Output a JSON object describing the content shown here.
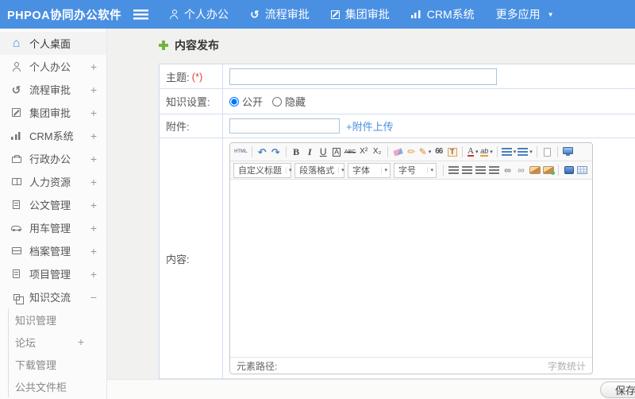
{
  "navbar": {
    "logo": "PHPOA协同办公软件",
    "items": [
      {
        "id": "personal-office",
        "label": "个人办公",
        "icon": "user-icon"
      },
      {
        "id": "workflow-approval",
        "label": "流程审批",
        "icon": "flow-icon"
      },
      {
        "id": "group-approval",
        "label": "集团审批",
        "icon": "edit-icon"
      },
      {
        "id": "crm-system",
        "label": "CRM系统",
        "icon": "chart-icon"
      },
      {
        "id": "more-apps",
        "label": "更多应用",
        "icon": null,
        "caret": true
      }
    ]
  },
  "sidebar": {
    "items": [
      {
        "id": "personal-desktop",
        "label": "个人桌面",
        "icon": "home-icon",
        "active": true
      },
      {
        "id": "personal-office",
        "label": "个人办公",
        "icon": "user-icon",
        "expander": "+"
      },
      {
        "id": "workflow-approval",
        "label": "流程审批",
        "icon": "flow-icon",
        "expander": "+"
      },
      {
        "id": "group-approval",
        "label": "集团审批",
        "icon": "edit-icon",
        "expander": "+"
      },
      {
        "id": "crm-system",
        "label": "CRM系统",
        "icon": "chart-icon",
        "expander": "+"
      },
      {
        "id": "admin-office",
        "label": "行政办公",
        "icon": "briefcase-icon",
        "expander": "+"
      },
      {
        "id": "human-resources",
        "label": "人力资源",
        "icon": "book-icon",
        "expander": "+"
      },
      {
        "id": "document-management",
        "label": "公文管理",
        "icon": "document-icon",
        "expander": "+"
      },
      {
        "id": "vehicle-management",
        "label": "用车管理",
        "icon": "car-icon",
        "expander": "+"
      },
      {
        "id": "archive-management",
        "label": "档案管理",
        "icon": "archive-icon",
        "expander": "+"
      },
      {
        "id": "project-management",
        "label": "项目管理",
        "icon": "project-icon",
        "expander": "+"
      },
      {
        "id": "knowledge-exchange",
        "label": "知识交流",
        "icon": "knowledge-icon",
        "expander": "−",
        "expanded": true
      }
    ],
    "subitems": [
      {
        "id": "knowledge-management",
        "label": "知识管理"
      },
      {
        "id": "forum",
        "label": "论坛",
        "expander": "+"
      },
      {
        "id": "download-management",
        "label": "下载管理"
      },
      {
        "id": "public-file-cabinet",
        "label": "公共文件柜"
      }
    ]
  },
  "main": {
    "title": "内容发布",
    "form": {
      "subject_label": "主题:",
      "required_mark": "(*)",
      "subject_value": "",
      "knowledge_label": "知识设置:",
      "knowledge_options": [
        {
          "id": "public",
          "label": "公开",
          "selected": true
        },
        {
          "id": "hidden",
          "label": "隐藏",
          "selected": false
        }
      ],
      "attachment_label": "附件:",
      "attachment_value": "",
      "attachment_upload_link": "+附件上传",
      "content_label": "内容:"
    },
    "editor": {
      "toolbar_row1": [
        {
          "icon": "html-source-icon"
        },
        {
          "sep": true
        },
        {
          "icon": "undo-icon"
        },
        {
          "icon": "redo-icon"
        },
        {
          "sep": true
        },
        {
          "icon": "bold-icon"
        },
        {
          "icon": "italic-icon"
        },
        {
          "icon": "underline-icon"
        },
        {
          "icon": "autotypeset-icon"
        },
        {
          "icon": "strikethrough-icon"
        },
        {
          "icon": "superscript-icon"
        },
        {
          "icon": "subscript-icon"
        },
        {
          "sep": true
        },
        {
          "icon": "eraser-icon"
        },
        {
          "icon": "clear-format-icon"
        },
        {
          "icon": "format-painter-icon",
          "caret": true
        },
        {
          "icon": "blockquote-icon"
        },
        {
          "icon": "paste-text-icon"
        },
        {
          "sep": true
        },
        {
          "icon": "font-color-icon",
          "caret": true
        },
        {
          "icon": "highlight-icon",
          "caret": true
        },
        {
          "sep": true
        },
        {
          "icon": "ordered-list-icon",
          "caret": true
        },
        {
          "icon": "unordered-list-icon",
          "caret": true
        },
        {
          "sep": true
        },
        {
          "icon": "new-page-icon"
        },
        {
          "sep": true
        },
        {
          "icon": "fullscreen-icon"
        }
      ],
      "toolbar_row2": [
        {
          "dropdown": true,
          "id": "custom-title",
          "label": "自定义标题"
        },
        {
          "dropdown": true,
          "id": "paragraph-format",
          "label": "段落格式"
        },
        {
          "dropdown": true,
          "id": "font-family",
          "label": "字体"
        },
        {
          "dropdown": true,
          "id": "font-size",
          "label": "字号"
        },
        {
          "sep": true
        },
        {
          "icon": "align-left-icon"
        },
        {
          "icon": "align-center-icon"
        },
        {
          "icon": "align-right-icon"
        },
        {
          "icon": "justify-icon"
        },
        {
          "icon": "link-icon"
        },
        {
          "icon": "unlink-icon"
        },
        {
          "icon": "image-icon"
        },
        {
          "icon": "insert-image-icon"
        },
        {
          "sep": true
        },
        {
          "icon": "media-icon"
        },
        {
          "icon": "table-icon"
        }
      ],
      "status_left": "元素路径:",
      "status_right": "字数统计"
    },
    "save_button": "保存"
  },
  "colors": {
    "navbar_bg": "#4a90e2",
    "accent_blue": "#4a90e2",
    "title_plus_green": "#6fb33a",
    "required_red": "#e04040",
    "link_blue": "#4a90e2"
  }
}
